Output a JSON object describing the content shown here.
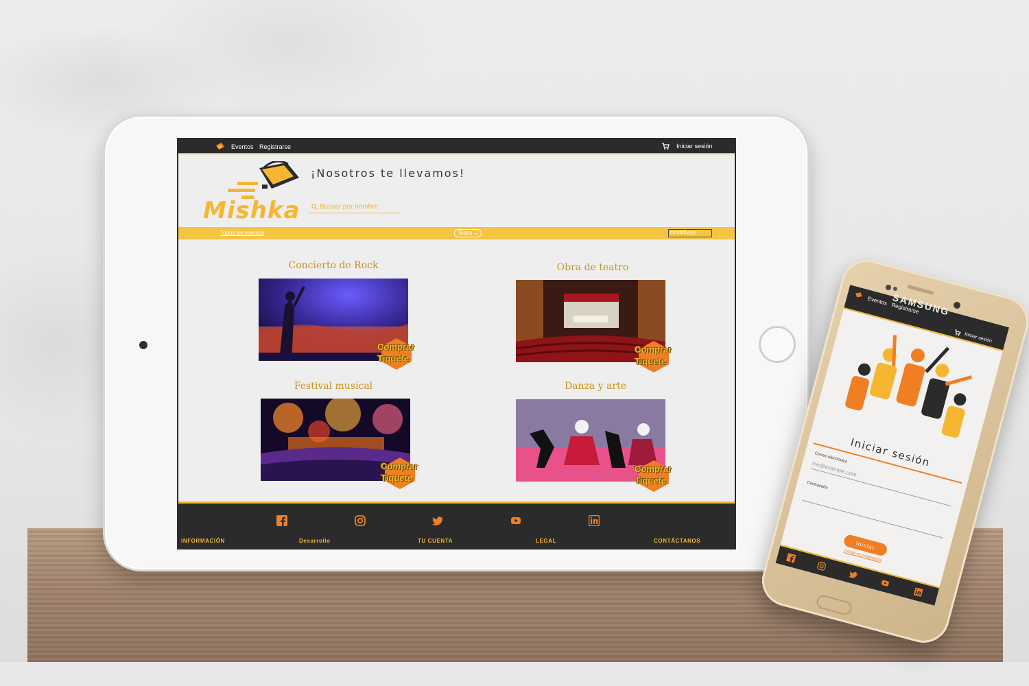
{
  "tablet": {
    "topbar": {
      "nav": [
        "Eventos",
        "Registrarse"
      ],
      "login": "Iniciar sesión"
    },
    "header": {
      "logo_text": "Mishka",
      "tagline": "¡Nosotros te llevamos!",
      "search_placeholder": "Buscar por nombre"
    },
    "filters": {
      "all_events": "Todos los eventos",
      "category_select": "Todos",
      "date_placeholder": "mm/dd/yyyy"
    },
    "events": [
      {
        "title": "Concierto de Rock",
        "buy_line1": "Comprar",
        "buy_line2": "Tiquete"
      },
      {
        "title": "Obra de teatro",
        "buy_line1": "Comprar",
        "buy_line2": "Tiquete"
      },
      {
        "title": "Festival musical",
        "buy_line1": "Comprar",
        "buy_line2": "Tiquete"
      },
      {
        "title": "Danza y arte",
        "buy_line1": "Comprar",
        "buy_line2": "Tiquete"
      }
    ],
    "footer": {
      "labels": [
        "INFORMACIÓN",
        "Desarrollo",
        "TU CUENTA",
        "LEGAL",
        "CONTÁCTANOS"
      ],
      "social_icons": [
        "facebook-icon",
        "instagram-icon",
        "twitter-icon",
        "youtube-icon",
        "linkedin-icon"
      ]
    }
  },
  "phone": {
    "brand": "SAMSUNG",
    "topbar": {
      "nav": [
        "Eventos",
        "Registrarse"
      ],
      "login": "Iniciar sesión"
    },
    "login": {
      "title": "Iniciar sesión",
      "email_label": "Correo electrónico",
      "email_placeholder": "me@example.com",
      "password_label": "Contraseña",
      "submit": "Iniciar",
      "forgot": "Olvide mi contraseña"
    }
  },
  "colors": {
    "accent_yellow": "#f5b731",
    "accent_orange": "#f07f24",
    "dark": "#2b2b2b"
  }
}
